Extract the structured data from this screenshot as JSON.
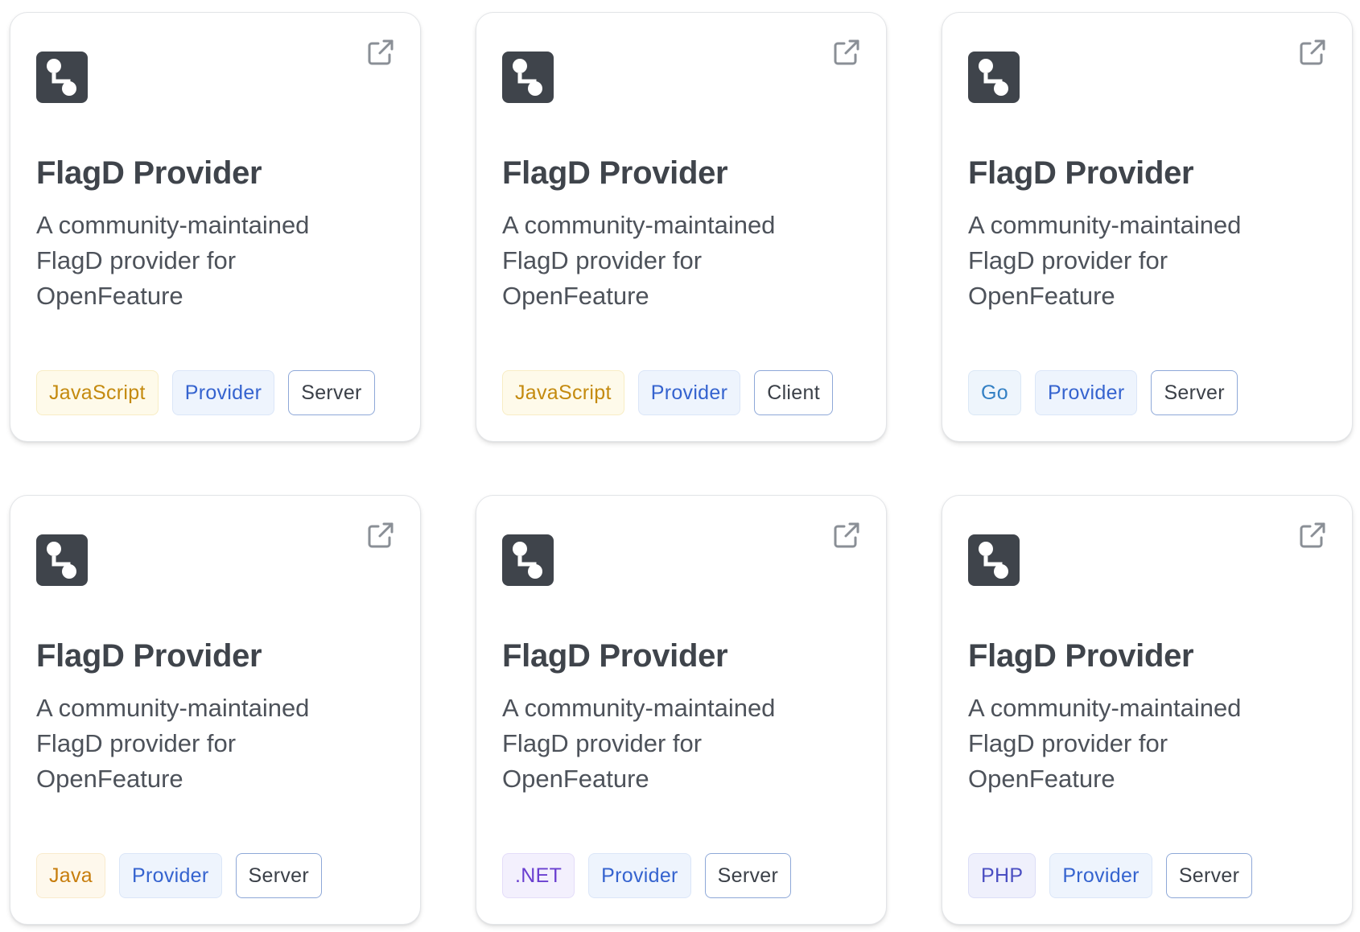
{
  "cards": [
    {
      "title": "FlagD Provider",
      "description": "A community-maintained FlagD provider for OpenFeature",
      "tags": {
        "language": "JavaScript",
        "type": "Provider",
        "environment": "Server"
      }
    },
    {
      "title": "FlagD Provider",
      "description": "A community-maintained FlagD provider for OpenFeature",
      "tags": {
        "language": "JavaScript",
        "type": "Provider",
        "environment": "Client"
      }
    },
    {
      "title": "FlagD Provider",
      "description": "A community-maintained FlagD provider for OpenFeature",
      "tags": {
        "language": "Go",
        "type": "Provider",
        "environment": "Server"
      }
    },
    {
      "title": "FlagD Provider",
      "description": "A community-maintained FlagD provider for OpenFeature",
      "tags": {
        "language": "Java",
        "type": "Provider",
        "environment": "Server"
      }
    },
    {
      "title": "FlagD Provider",
      "description": "A community-maintained FlagD provider for OpenFeature",
      "tags": {
        "language": ".NET",
        "type": "Provider",
        "environment": "Server"
      }
    },
    {
      "title": "FlagD Provider",
      "description": "A community-maintained FlagD provider for OpenFeature",
      "tags": {
        "language": "PHP",
        "type": "Provider",
        "environment": "Server"
      }
    }
  ],
  "icons": {
    "logo": "flag-branch-icon",
    "external": "external-link-icon"
  },
  "colors": {
    "logo_bg": "#3f444b",
    "title": "#3f444b",
    "description": "#4d525a",
    "card_border": "#e3e5e8"
  }
}
